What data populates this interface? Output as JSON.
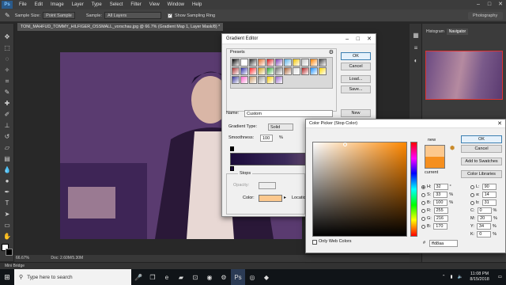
{
  "app": {
    "logo": "Ps"
  },
  "menu": [
    "File",
    "Edit",
    "Image",
    "Layer",
    "Type",
    "Select",
    "Filter",
    "View",
    "Window",
    "Help"
  ],
  "options_bar": {
    "sample_size_label": "Sample Size:",
    "sample_size_value": "Point Sample",
    "sample_label": "Sample:",
    "sample_value": "All Layers",
    "show_ring_label": "Show Sampling Ring",
    "workspace": "Photography"
  },
  "document_tab": "TONI_MAHFUD_TOMMY_HILFIGER_OSSMALL_vorschau.jpg @ 66.7% (Gradient Map 1, Layer Mask/8) *",
  "status_bar": {
    "zoom": "66.67%",
    "doc": "Doc: 2.60M/5.30M"
  },
  "mini_bridge": "Mini Bridge",
  "panels": {
    "histogram_tab": "Histogram",
    "navigator_tab": "Navigator"
  },
  "gradient_editor": {
    "title": "Gradient Editor",
    "presets_label": "Presets",
    "buttons": {
      "ok": "OK",
      "cancel": "Cancel",
      "load": "Load...",
      "save": "Save...",
      "new": "New"
    },
    "name_label": "Name:",
    "name_value": "Custom",
    "gradient_type_label": "Gradient Type:",
    "gradient_type_value": "Solid",
    "smoothness_label": "Smoothness:",
    "smoothness_value": "100",
    "smoothness_unit": "%",
    "stops_label": "Stops",
    "opacity_label": "Opacity:",
    "color_label": "Color:",
    "location_label": "Location",
    "preset_swatches": [
      "#000000",
      "#ffffff",
      "#2b2b2b",
      "#e06a2a",
      "#d91c1c",
      "#7a3fb5",
      "#5bb0e6",
      "#f2c400",
      "#c8c8c8",
      "#ff8000",
      "#444444",
      "#aa3333",
      "#3333aa",
      "#ff2a2a",
      "#d4a017",
      "#33aa33",
      "#777777",
      "#a55c2f",
      "#e0e0e0",
      "#b22222",
      "#1e90ff",
      "#ffd700",
      "#333399",
      "#ff66cc",
      "#cc9966",
      "#999999",
      "#ffcc00",
      "#9966cc"
    ]
  },
  "color_picker": {
    "title": "Color Picker (Stop Color)",
    "new_label": "new",
    "current_label": "current",
    "new_color": "#fcc88e",
    "current_color": "#f58f1f",
    "buttons": {
      "ok": "OK",
      "cancel": "Cancel",
      "add_swatches": "Add to Swatches",
      "color_libraries": "Color Libraries"
    },
    "hsb": [
      {
        "k": "H:",
        "v": "32",
        "u": "°"
      },
      {
        "k": "S:",
        "v": "33",
        "u": "%"
      },
      {
        "k": "B:",
        "v": "100",
        "u": "%"
      },
      {
        "k": "R:",
        "v": "255",
        "u": ""
      },
      {
        "k": "G:",
        "v": "216",
        "u": ""
      },
      {
        "k": "B:",
        "v": "170",
        "u": ""
      }
    ],
    "lab": [
      {
        "k": "L:",
        "v": "90",
        "u": ""
      },
      {
        "k": "a:",
        "v": "14",
        "u": ""
      },
      {
        "k": "b:",
        "v": "31",
        "u": ""
      },
      {
        "k": "C:",
        "v": "0",
        "u": "%"
      },
      {
        "k": "M:",
        "v": "20",
        "u": "%"
      },
      {
        "k": "Y:",
        "v": "34",
        "u": "%"
      },
      {
        "k": "K:",
        "v": "0",
        "u": "%"
      }
    ],
    "hex_label": "#",
    "hex_value": "ffd8aa",
    "only_web_colors": "Only Web Colors"
  },
  "taskbar": {
    "search_placeholder": "Type here to search",
    "time": "11:08 PM",
    "date": "8/15/2018"
  }
}
